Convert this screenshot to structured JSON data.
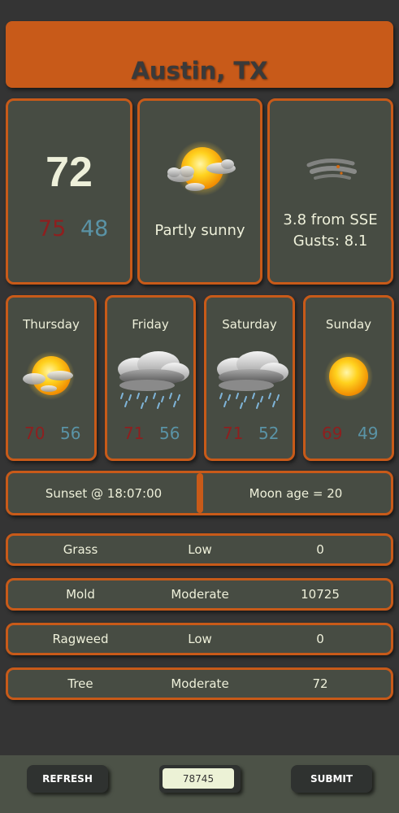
{
  "header": {
    "city": "Austin, TX"
  },
  "current": {
    "temp": "72",
    "high": "75",
    "low": "48",
    "condition": "Partly sunny",
    "condition_icon": "partly-sunny-icon",
    "wind_line1": "3.8 from SSE",
    "wind_line2": "Gusts: 8.1",
    "wind_icon": "wind-icon"
  },
  "forecast": [
    {
      "day": "Thursday",
      "high": "70",
      "low": "56",
      "icon": "partly-sunny-icon"
    },
    {
      "day": "Friday",
      "high": "71",
      "low": "56",
      "icon": "rain-cloud-icon"
    },
    {
      "day": "Saturday",
      "high": "71",
      "low": "52",
      "icon": "rain-cloud-icon"
    },
    {
      "day": "Sunday",
      "high": "69",
      "low": "49",
      "icon": "sun-icon"
    }
  ],
  "astro": {
    "sunset": "Sunset @ 18:07:00",
    "moon": "Moon age = 20"
  },
  "pollen": [
    {
      "type": "Grass",
      "level": "Low",
      "count": "0"
    },
    {
      "type": "Mold",
      "level": "Moderate",
      "count": "10725"
    },
    {
      "type": "Ragweed",
      "level": "Low",
      "count": "0"
    },
    {
      "type": "Tree",
      "level": "Moderate",
      "count": "72"
    }
  ],
  "controls": {
    "refresh_label": "REFRESH",
    "zip_value": "78745",
    "submit_label": "SUBMIT"
  },
  "colors": {
    "accent": "#c85a19",
    "panel": "#474c43",
    "background": "#343434",
    "high_temp": "#8e1f1f",
    "low_temp": "#5a93a6"
  }
}
